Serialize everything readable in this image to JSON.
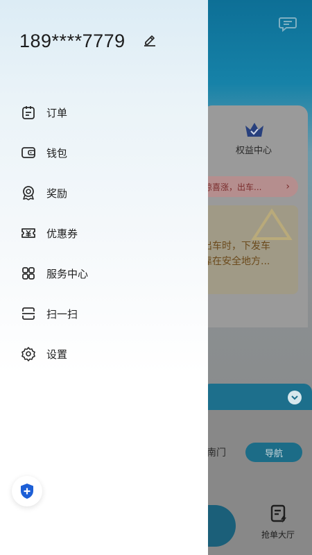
{
  "colors": {
    "accent": "#1d5fd6",
    "drawer_bg_top": "#dcecf5",
    "text_primary": "#1e1e1e"
  },
  "drawer": {
    "phone_number": "189****7779",
    "edit_icon": "pencil-edit-icon",
    "menu": [
      {
        "label": "订单",
        "icon": "order-list-icon"
      },
      {
        "label": "钱包",
        "icon": "wallet-icon"
      },
      {
        "label": "奖励",
        "icon": "reward-medal-icon"
      },
      {
        "label": "优惠券",
        "icon": "coupon-icon"
      },
      {
        "label": "服务中心",
        "icon": "service-grid-icon"
      },
      {
        "label": "扫一扫",
        "icon": "scan-icon"
      },
      {
        "label": "设置",
        "icon": "settings-gear-icon"
      }
    ],
    "safety_button_icon": "shield-plus-icon"
  },
  "background": {
    "chat_icon": "chat-bubble-icon",
    "rights_center_label": "权益中心",
    "price_banner_text": "惊喜涨，出车...",
    "warning_text_line1": "出车时，下发车",
    "warning_text_line2": "靠在安全地方...",
    "address_fragment": "南门",
    "navigate_button": "导航",
    "grab_order_hall": "抢单大厅"
  }
}
